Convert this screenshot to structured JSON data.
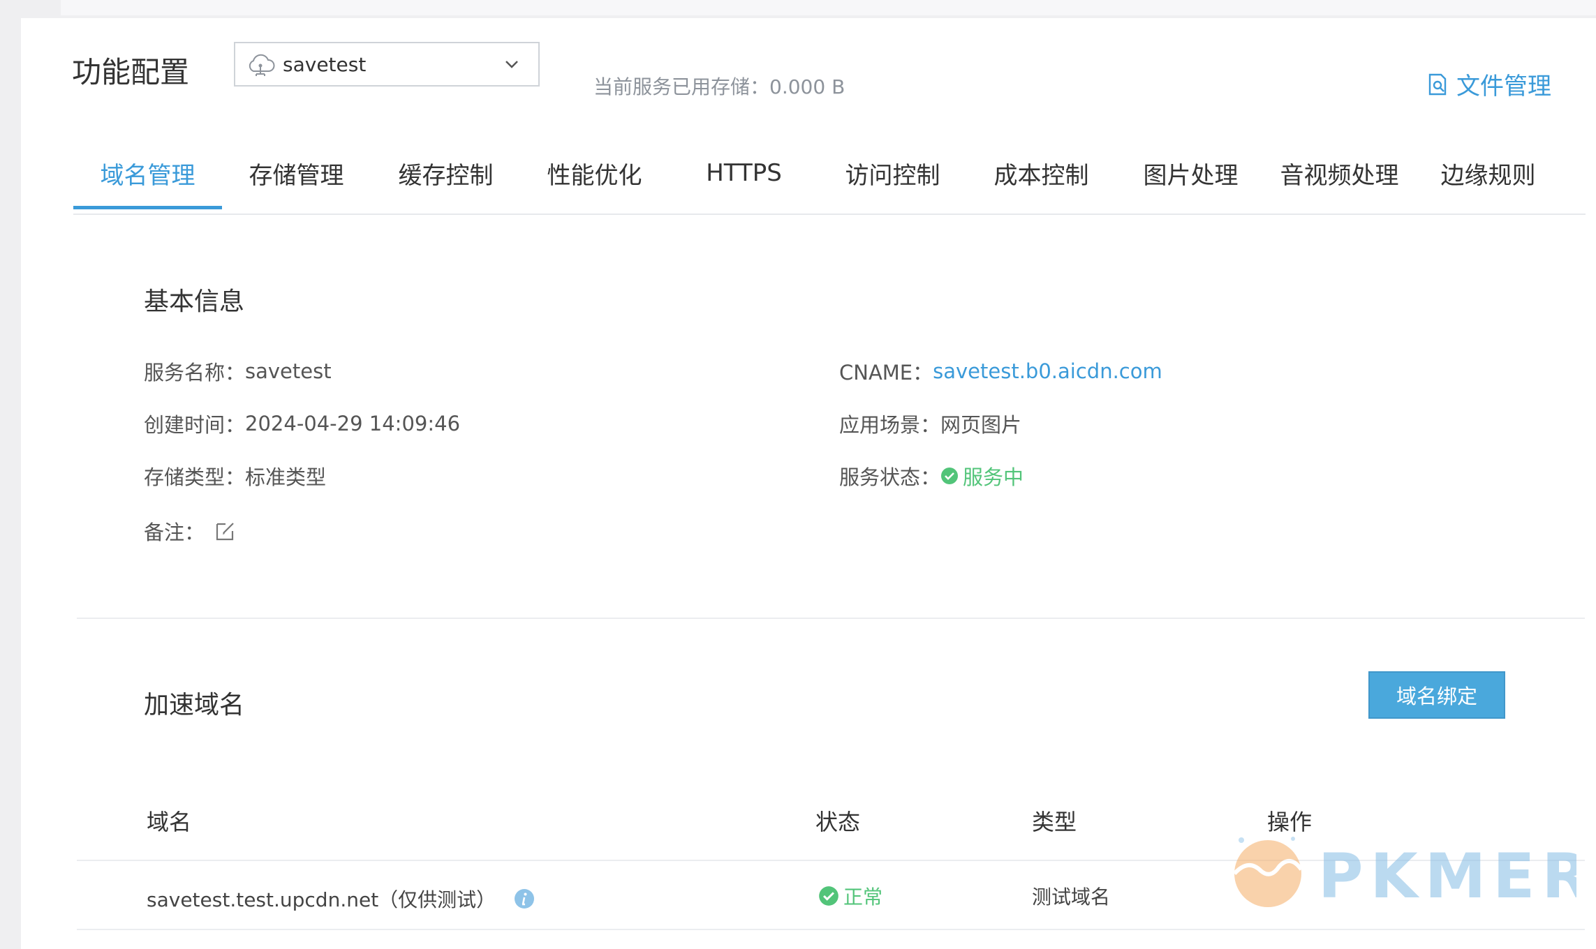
{
  "header": {
    "title": "功能配置",
    "service_select_value": "savetest",
    "storage_label": "当前服务已用存储：",
    "storage_value": "0.000 B",
    "file_management_label": "文件管理"
  },
  "tabs": [
    {
      "label": "域名管理",
      "active": true
    },
    {
      "label": "存储管理"
    },
    {
      "label": "缓存控制"
    },
    {
      "label": "性能优化"
    },
    {
      "label": "HTTPS"
    },
    {
      "label": "访问控制"
    },
    {
      "label": "成本控制"
    },
    {
      "label": "图片处理"
    },
    {
      "label": "音视频处理"
    },
    {
      "label": "边缘规则"
    }
  ],
  "basic_info": {
    "title": "基本信息",
    "service_name_label": "服务名称：",
    "service_name_value": "savetest",
    "created_label": "创建时间：",
    "created_value": "2024-04-29 14:09:46",
    "storage_type_label": "存储类型：",
    "storage_type_value": "标准类型",
    "remark_label": "备注：",
    "cname_label": "CNAME：",
    "cname_value": "savetest.b0.aicdn.com",
    "scenario_label": "应用场景：",
    "scenario_value": "网页图片",
    "status_label": "服务状态：",
    "status_value": "服务中",
    "status_color": "#52c479"
  },
  "accelerated_domains": {
    "title": "加速域名",
    "bind_button_label": "域名绑定",
    "columns": [
      "域名",
      "状态",
      "类型",
      "操作"
    ],
    "rows": [
      {
        "domain": "savetest.test.upcdn.net（仅供测试）",
        "status": "正常",
        "type": "测试域名",
        "action": ""
      }
    ]
  },
  "watermark": {
    "text": "PKMER"
  },
  "colors": {
    "accent": "#3a9ad9",
    "button": "#4aa8dc",
    "success": "#52c479"
  }
}
